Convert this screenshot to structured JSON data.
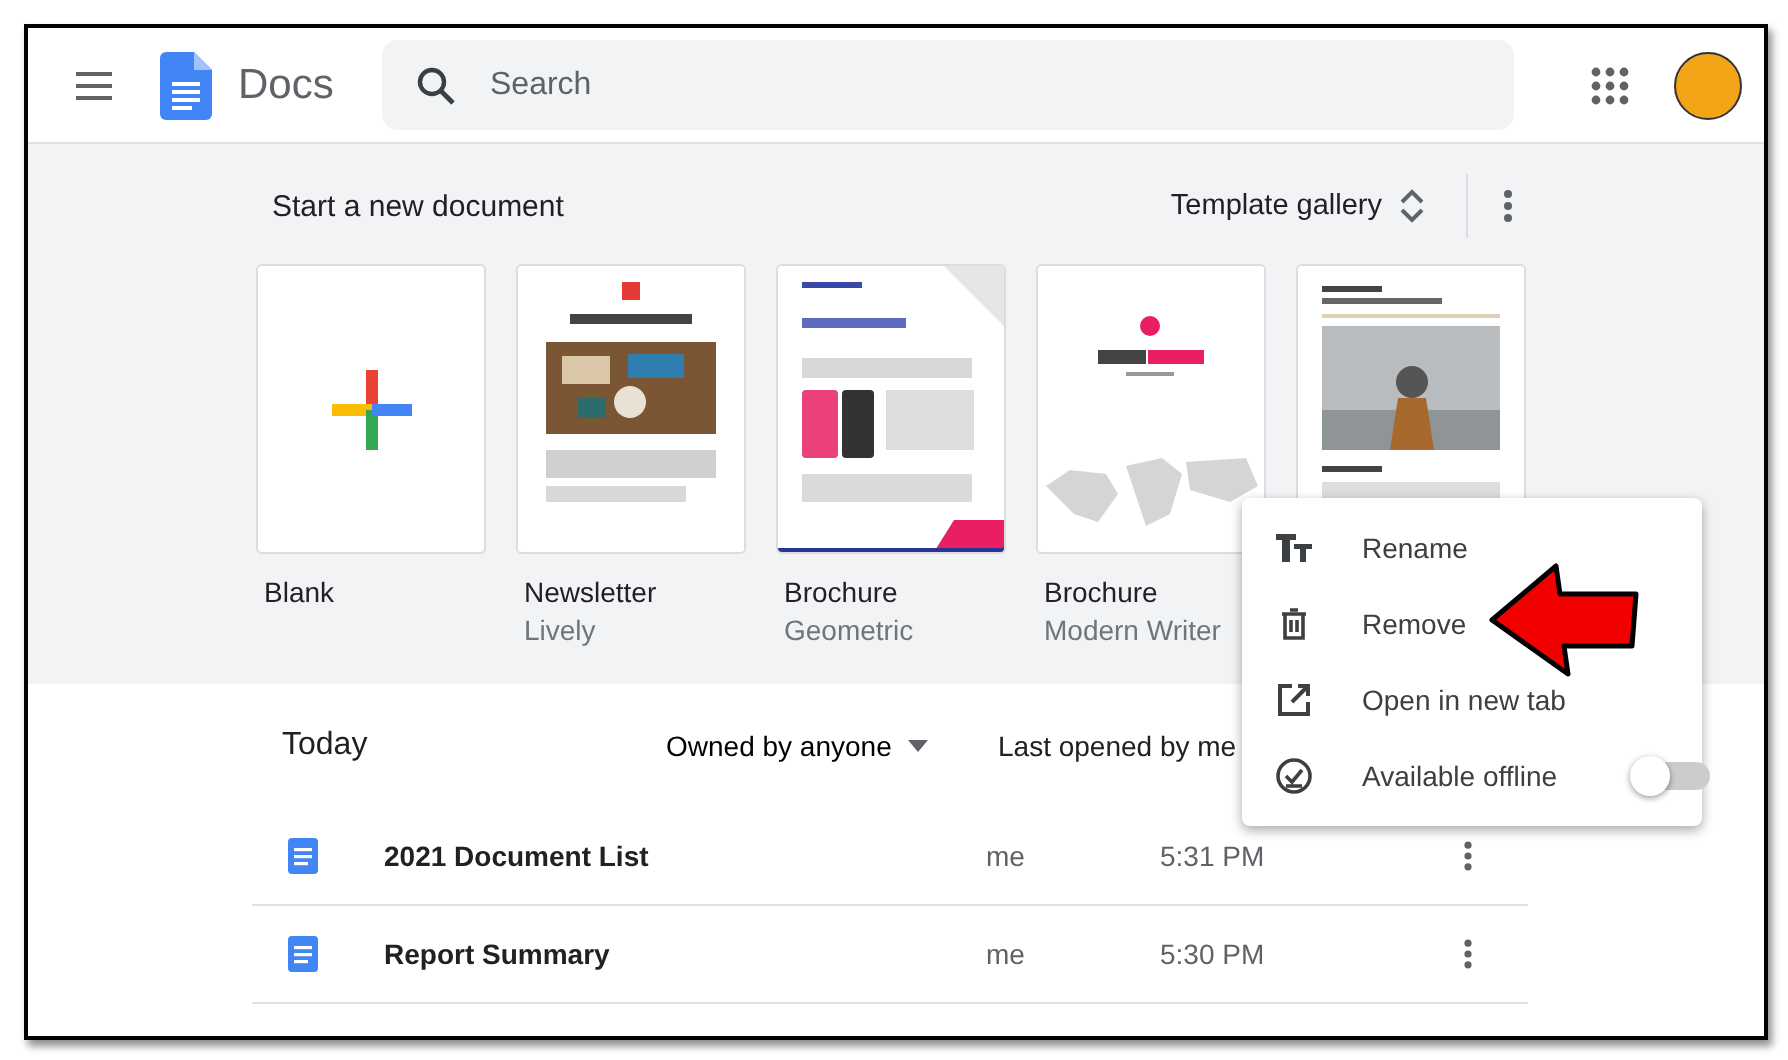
{
  "header": {
    "app_name": "Docs",
    "search": {
      "placeholder": "Search"
    }
  },
  "templates": {
    "heading": "Start a new document",
    "gallery_button": "Template gallery",
    "items": [
      {
        "name": "Blank",
        "kind": "blank"
      },
      {
        "name": "Newsletter",
        "subtitle": "Lively",
        "kind": "picture"
      },
      {
        "name": "Brochure",
        "subtitle": "Geometric",
        "kind": "picture"
      },
      {
        "name": "Brochure",
        "subtitle": "Modern Writer",
        "kind": "picture"
      },
      {
        "kind": "picture"
      }
    ]
  },
  "documents": {
    "heading": "Today",
    "owner_filter": "Owned by anyone",
    "sort": "Last opened by me",
    "rows": [
      {
        "title": "2021 Document List",
        "owner": "me",
        "time": "5:31 PM"
      },
      {
        "title": "Report Summary",
        "owner": "me",
        "time": "5:30 PM"
      }
    ]
  },
  "context_menu": {
    "items": [
      {
        "label": "Rename",
        "kind": "action"
      },
      {
        "label": "Remove",
        "kind": "action"
      },
      {
        "label": "Open in new tab",
        "kind": "action"
      },
      {
        "label": "Available offline",
        "kind": "toggle",
        "on": false
      }
    ]
  },
  "annotations": [
    {
      "kind": "arrow"
    }
  ]
}
